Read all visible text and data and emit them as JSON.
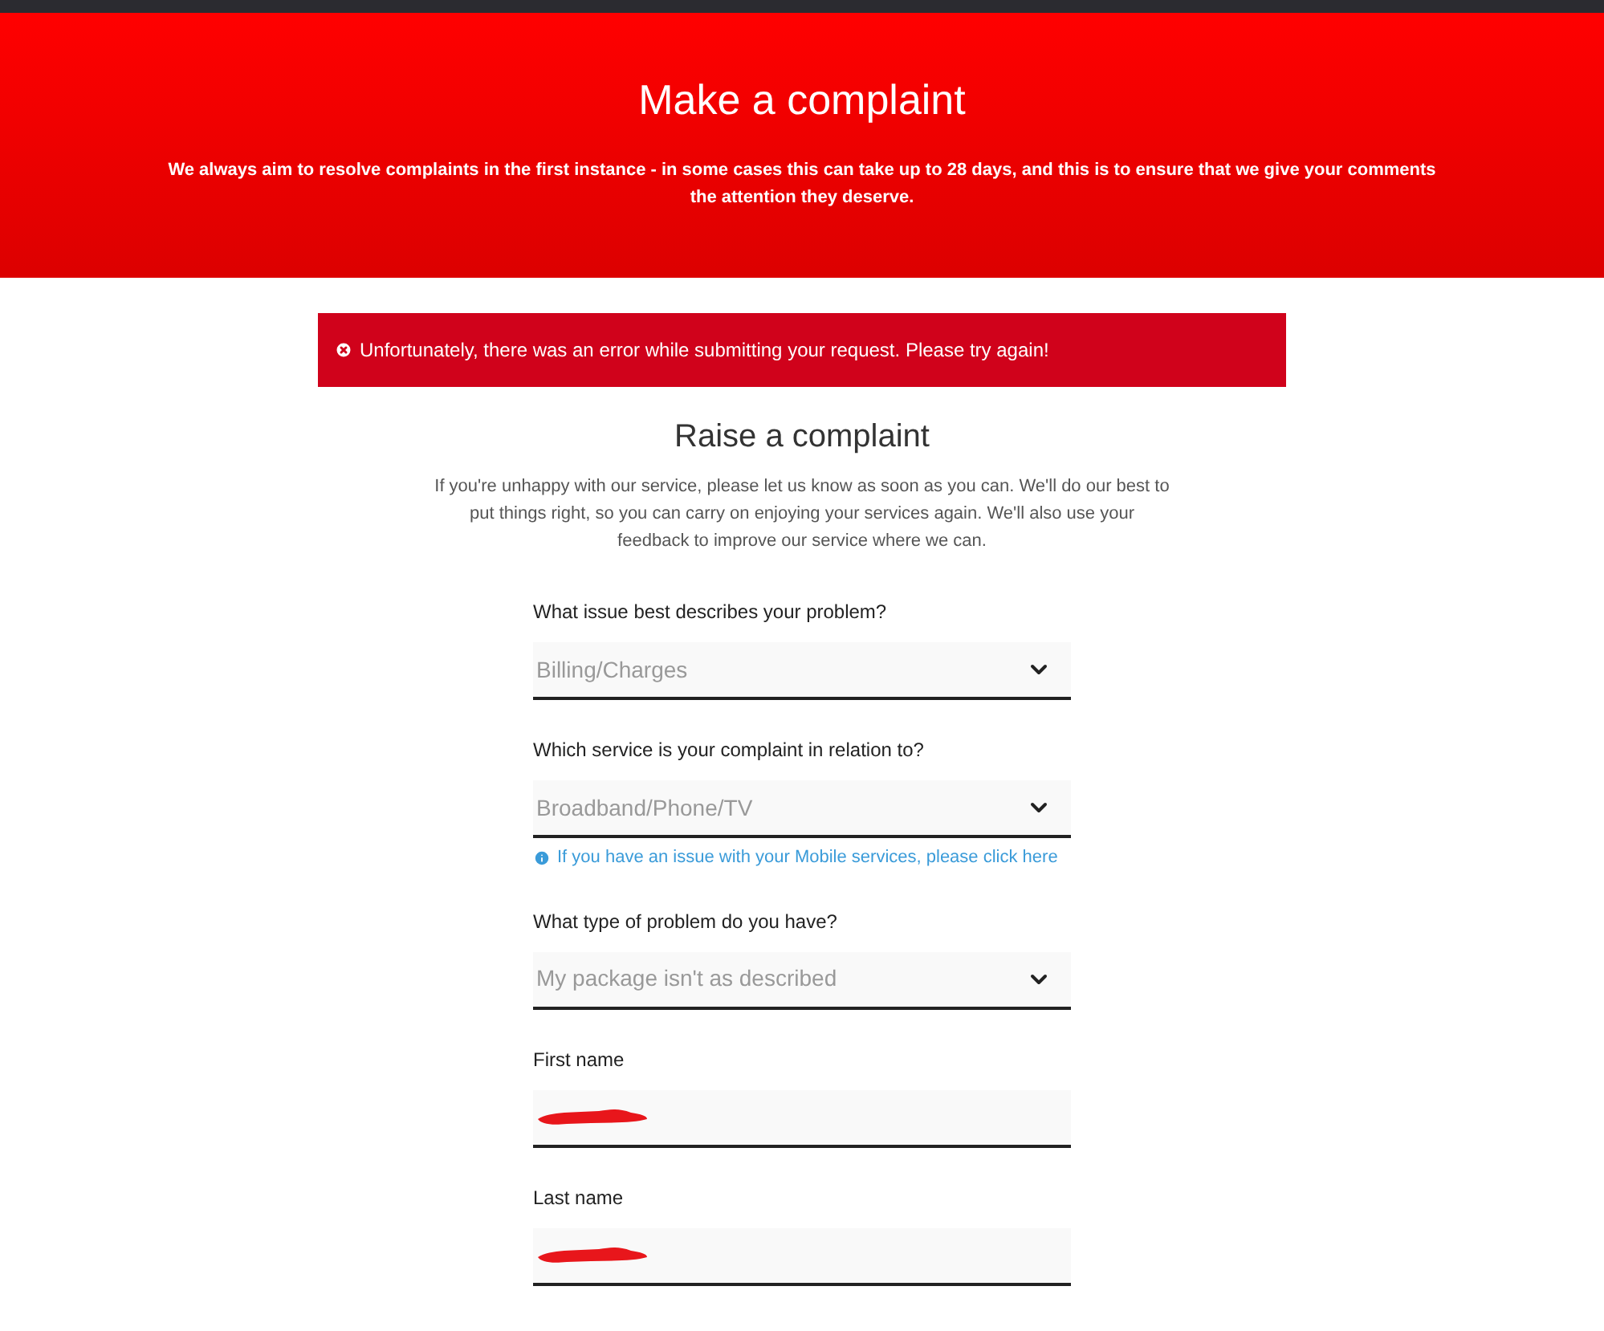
{
  "header": {
    "title": "Make a complaint",
    "subtitle": "We always aim to resolve complaints in the first instance - in some cases this can take up to 28 days, and this is to ensure that we give your comments the attention they deserve."
  },
  "error_alert": {
    "message": "Unfortunately, there was an error while submitting your request. Please try again!"
  },
  "section": {
    "title": "Raise a complaint",
    "intro": "If you're unhappy with our service, please let us know as soon as you can. We'll do our best to put things right, so you can carry on enjoying your services again. We'll also use your feedback to improve our service where we can."
  },
  "fields": [
    {
      "kind": "select",
      "label": "What issue best describes your problem?",
      "value": "Billing/Charges"
    },
    {
      "kind": "select",
      "label": "Which service is your complaint in relation to?",
      "value": "Broadband/Phone/TV",
      "info_link": "If you have an issue with your Mobile services, please click here"
    },
    {
      "kind": "select",
      "label": "What type of problem do you have?",
      "value": "My package isn't as described"
    },
    {
      "kind": "redacted",
      "label": "First name"
    },
    {
      "kind": "redacted",
      "label": "Last name"
    }
  ]
}
